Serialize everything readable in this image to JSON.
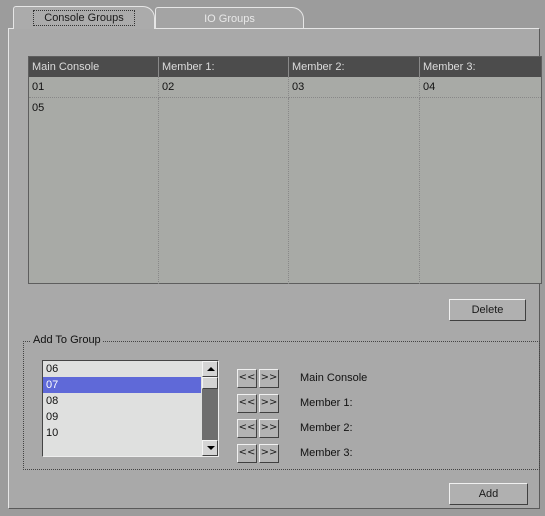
{
  "tabs": [
    {
      "label": "Console Groups",
      "active": true
    },
    {
      "label": "IO Groups",
      "active": false
    }
  ],
  "table": {
    "columns": [
      "Main Console",
      "Member 1:",
      "Member 2:",
      "Member 3:"
    ],
    "rows": [
      [
        "01",
        "02",
        "03",
        "04"
      ],
      [
        "05",
        "",
        "",
        ""
      ]
    ]
  },
  "delete_label": "Delete",
  "add_to_group": {
    "title": "Add To Group",
    "list_items": [
      "06",
      "07",
      "08",
      "09",
      "10"
    ],
    "selected_item": "07",
    "move_left_label": "<<",
    "move_right_label": ">>",
    "targets": [
      "Main Console",
      "Member 1:",
      "Member 2:",
      "Member 3:"
    ]
  },
  "add_label": "Add",
  "colors": {
    "background": "#9c9c9c",
    "selection": "#5f69d8",
    "header": "#4c4c4c"
  },
  "icons": [
    "scroll-up-icon",
    "scroll-down-icon"
  ]
}
